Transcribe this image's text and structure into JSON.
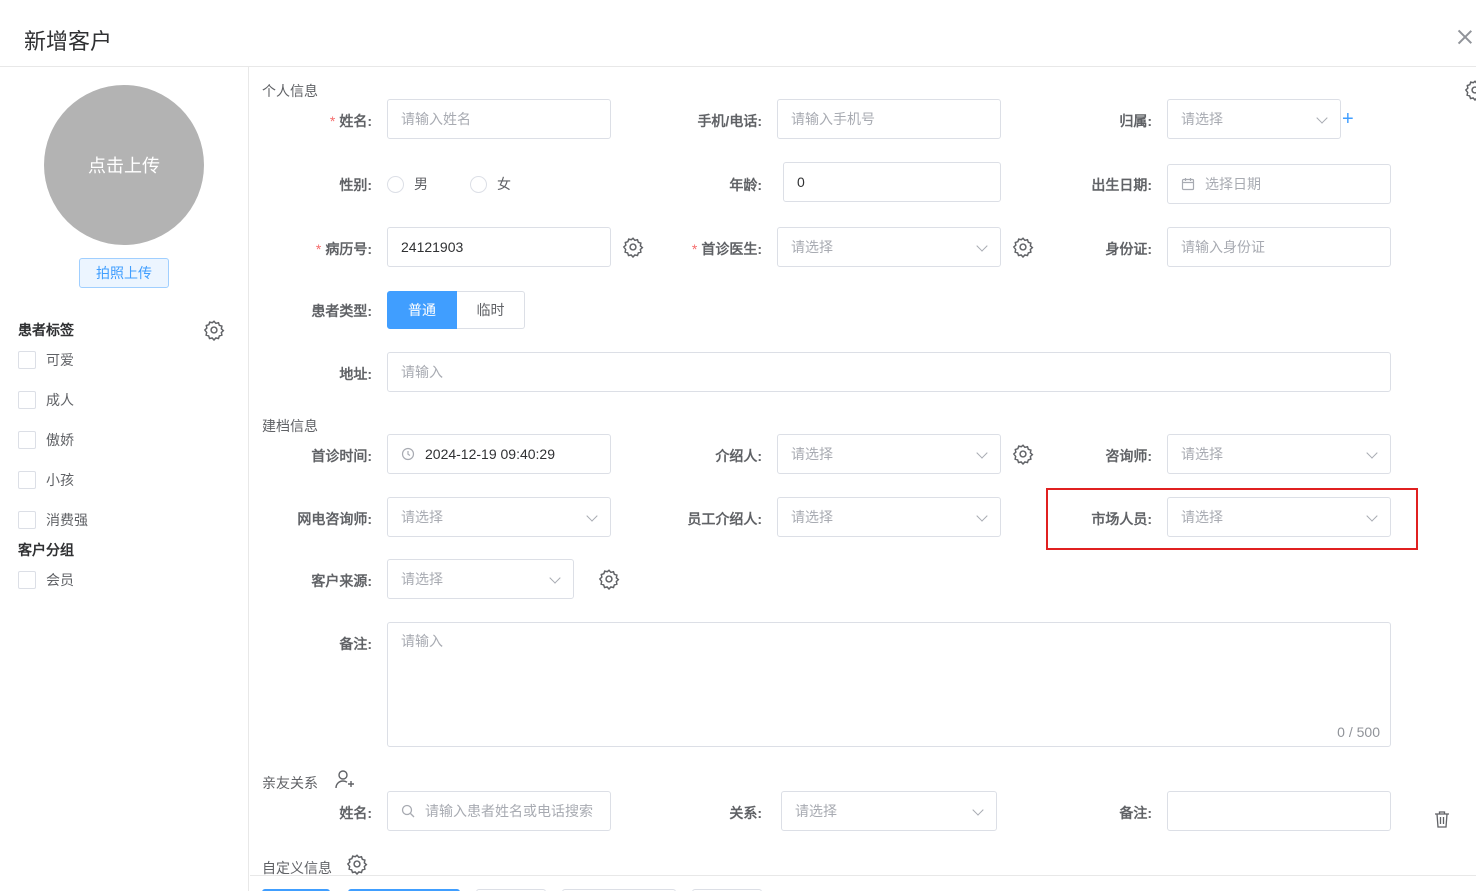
{
  "dialog": {
    "title": "新增客户"
  },
  "sidebar": {
    "avatar_text": "点击上传",
    "photo_button": "拍照上传",
    "tags_title": "患者标签",
    "tags": [
      "可爱",
      "成人",
      "傲娇",
      "小孩",
      "消费强"
    ],
    "groups_title": "客户分组",
    "groups": [
      "会员"
    ]
  },
  "personal": {
    "section_title": "个人信息",
    "name_label": "姓名:",
    "name_placeholder": "请输入姓名",
    "phone_label": "手机/电话:",
    "phone_placeholder": "请输入手机号",
    "belong_label": "归属:",
    "belong_placeholder": "请选择",
    "gender_label": "性别:",
    "gender_options": [
      "男",
      "女"
    ],
    "age_label": "年龄:",
    "age_value": "0",
    "birth_label": "出生日期:",
    "birth_placeholder": "选择日期",
    "record_label": "病历号:",
    "record_value": "24121903",
    "doctor_label": "首诊医生:",
    "doctor_placeholder": "请选择",
    "idcard_label": "身份证:",
    "idcard_placeholder": "请输入身份证",
    "type_label": "患者类型:",
    "type_options": [
      "普通",
      "临时"
    ],
    "type_selected": "普通",
    "address_label": "地址:",
    "address_placeholder": "请输入"
  },
  "archive": {
    "section_title": "建档信息",
    "first_visit_label": "首诊时间:",
    "first_visit_value": "2024-12-19 09:40:29",
    "referrer_label": "介绍人:",
    "referrer_placeholder": "请选择",
    "consultant_label": "咨询师:",
    "consultant_placeholder": "请选择",
    "online_consultant_label": "网电咨询师:",
    "online_consultant_placeholder": "请选择",
    "staff_referrer_label": "员工介绍人:",
    "staff_referrer_placeholder": "请选择",
    "market_label": "市场人员:",
    "market_placeholder": "请选择",
    "source_label": "客户来源:",
    "source_placeholder": "请选择",
    "remark_label": "备注:",
    "remark_placeholder": "请输入",
    "remark_counter": "0 / 500"
  },
  "relatives": {
    "section_title": "亲友关系",
    "name_label": "姓名:",
    "name_placeholder": "请输入患者姓名或电话搜索",
    "relation_label": "关系:",
    "relation_placeholder": "请选择",
    "remark_label": "备注:"
  },
  "custom": {
    "section_title": "自定义信息"
  },
  "colors": {
    "primary": "#409eff",
    "highlight": "#e02020",
    "required": "#f56c6c"
  }
}
